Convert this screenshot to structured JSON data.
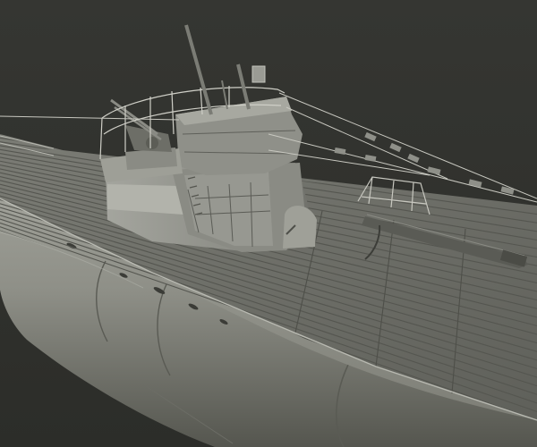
{
  "scene": {
    "colors": {
      "background": "#2f302c",
      "hull_light": "#a3a49b",
      "hull_mid": "#8b8c84",
      "hull_dark": "#4a4b45",
      "deck": "#6f706a",
      "deck_line": "#55564f",
      "tower": "#8d8e87",
      "tower_light": "#a9aaa3",
      "wire": "#c8c8c0"
    }
  }
}
